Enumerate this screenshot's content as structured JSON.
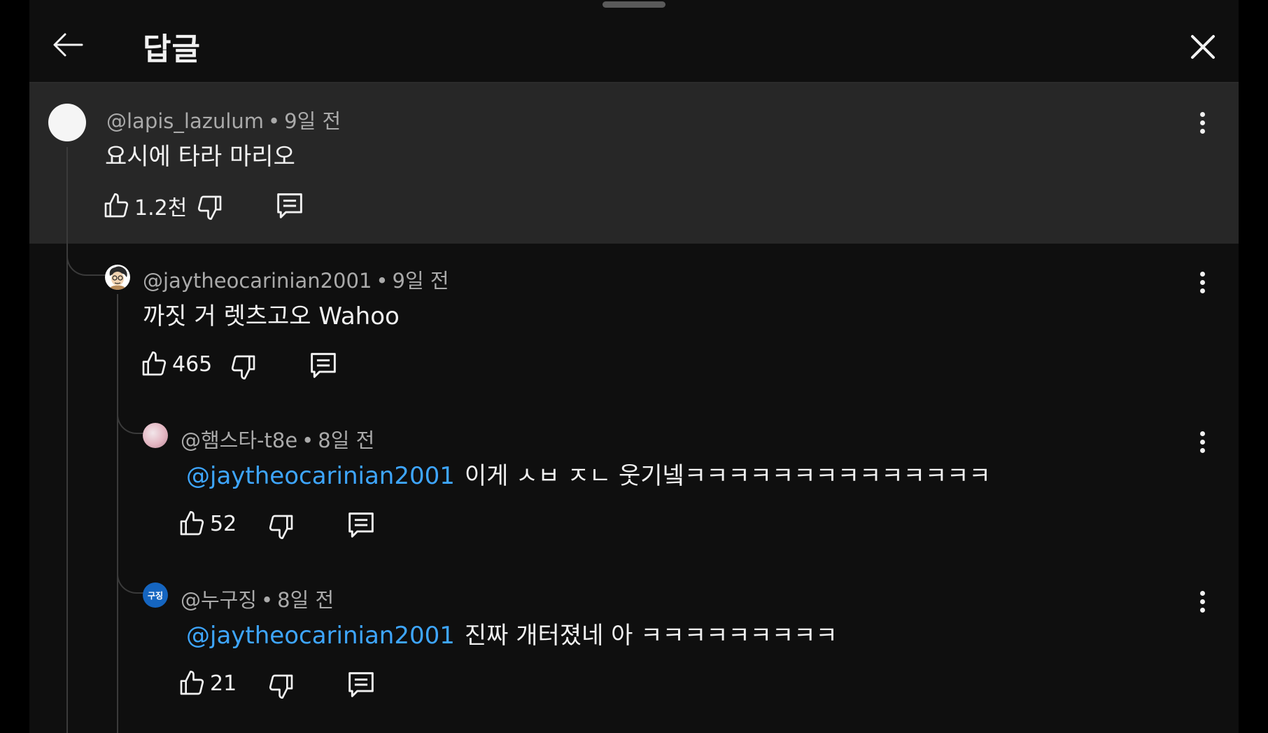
{
  "header": {
    "title": "답글"
  },
  "icons": {
    "back": "arrow-left-icon",
    "close": "close-icon",
    "more": "more-vert-icon",
    "like": "thumb-up-icon",
    "dislike": "thumb-down-icon",
    "reply": "comment-icon"
  },
  "colors": {
    "background": "#0f0f0f",
    "highlight": "#272727",
    "mention": "#3ea6ff",
    "meta": "#aaaaaa"
  },
  "comments": [
    {
      "author": "@lapis_lazulum",
      "time": "9일 전",
      "text": "요시에 타라 마리오",
      "likes": "1.2천",
      "highlighted": true
    },
    {
      "author": "@jaytheocarinian2001",
      "time": "9일 전",
      "text": "까짓 거 렛츠고오 Wahoo",
      "likes": "465"
    },
    {
      "author": "@햄스타-t8e",
      "time": "8일 전",
      "mention": "@jaytheocarinian2001",
      "text": "이게 ㅅㅂ ㅈㄴ 웃기넼ㅋㅋㅋㅋㅋㅋㅋㅋㅋㅋㅋㅋㅋㅋ",
      "likes": "52"
    },
    {
      "author": "@누구징",
      "avatar_text": "구징",
      "time": "8일 전",
      "mention": "@jaytheocarinian2001",
      "text": "진짜 개터졌네 아 ㅋㅋㅋㅋㅋㅋㅋㅋㅋ",
      "likes": "21"
    }
  ]
}
